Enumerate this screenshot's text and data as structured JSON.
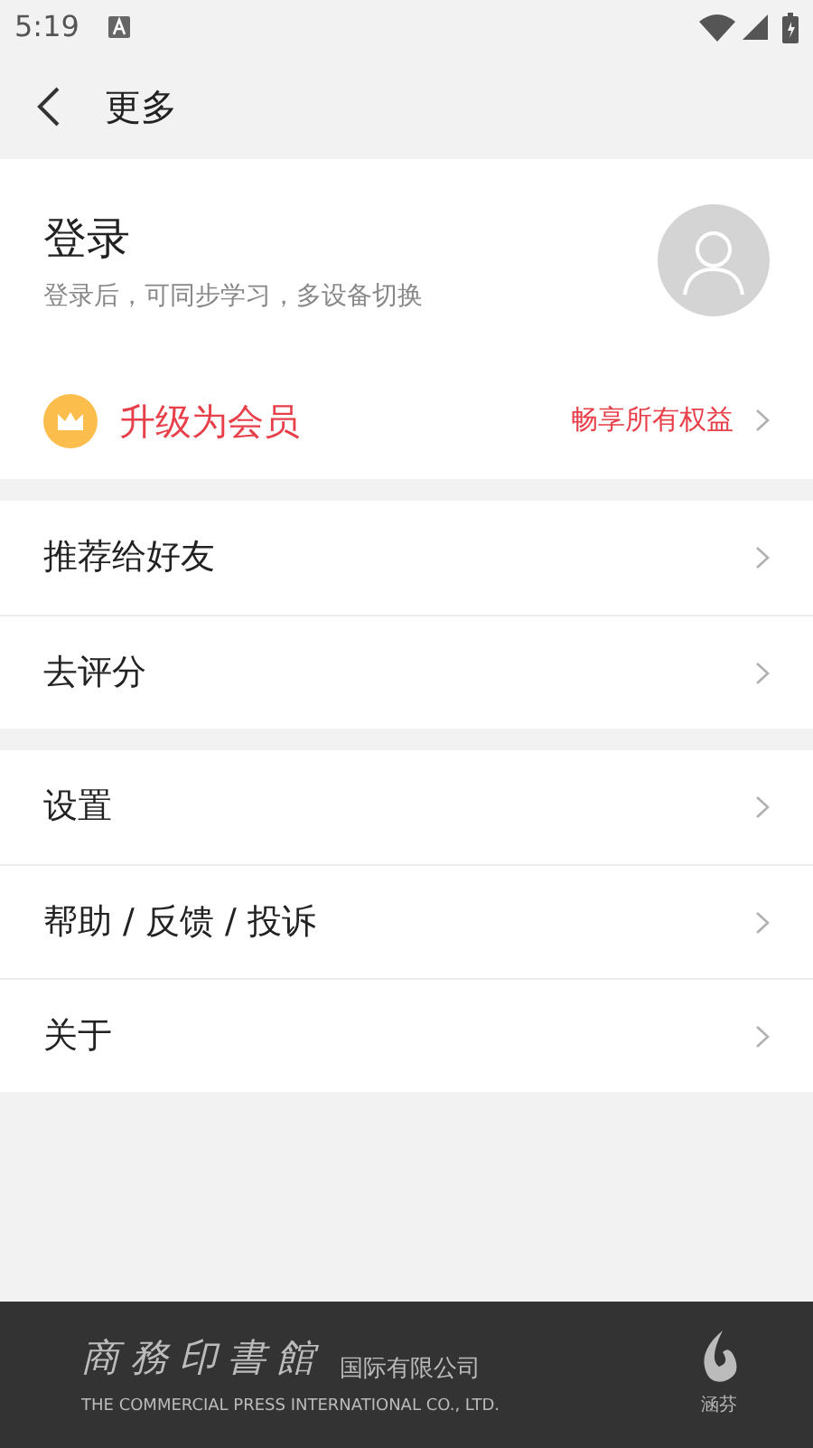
{
  "status_bar": {
    "time": "5:19"
  },
  "header": {
    "title": "更多"
  },
  "login": {
    "title": "登录",
    "subtitle": "登录后，可同步学习，多设备切换"
  },
  "member": {
    "label": "升级为会员",
    "benefit": "畅享所有权益"
  },
  "groups": [
    [
      {
        "label": "推荐给好友"
      },
      {
        "label": "去评分"
      }
    ],
    [
      {
        "label": "设置"
      },
      {
        "label": "帮助 / 反馈 / 投诉"
      },
      {
        "label": "关于"
      }
    ]
  ],
  "footer": {
    "brand": "商務印書館",
    "company": "国际有限公司",
    "english": "THE COMMERCIAL PRESS INTERNATIONAL CO., LTD.",
    "mark": "涵芬"
  }
}
